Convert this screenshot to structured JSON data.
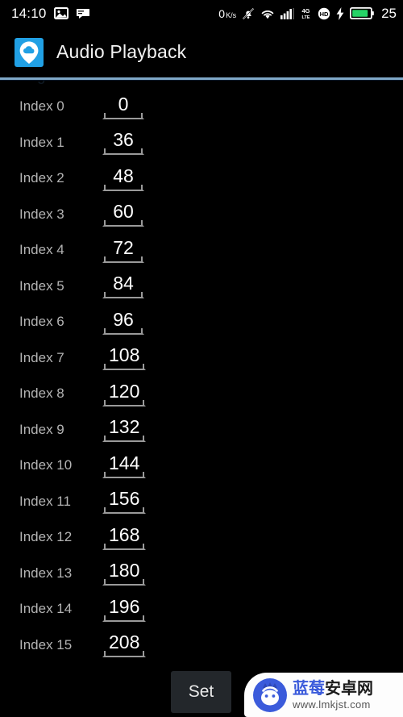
{
  "status_bar": {
    "clock": "14:10",
    "left_icons": [
      "image-icon",
      "message-icon"
    ],
    "data_rate": "0",
    "data_rate_unit": "K/s",
    "right_icons": [
      "mute-bell-icon",
      "wifi-icon",
      "signal-bars-icon",
      "4g-lte-icon",
      "hd-icon",
      "charging-bolt-icon",
      "battery-icon"
    ],
    "battery_percent": "25",
    "battery_color": "#25d366"
  },
  "app_bar": {
    "icon_name": "app-cloud-pin-icon",
    "icon_bg": "#21a0e4",
    "title": "Audio Playback"
  },
  "content": {
    "ghost_section_label": "Digital Gain",
    "divider_color": "#7fa8c9",
    "rows": [
      {
        "label": "Index 0",
        "value": "0"
      },
      {
        "label": "Index 1",
        "value": "36"
      },
      {
        "label": "Index 2",
        "value": "48"
      },
      {
        "label": "Index 3",
        "value": "60"
      },
      {
        "label": "Index 4",
        "value": "72"
      },
      {
        "label": "Index 5",
        "value": "84"
      },
      {
        "label": "Index 6",
        "value": "96"
      },
      {
        "label": "Index 7",
        "value": "108"
      },
      {
        "label": "Index 8",
        "value": "120"
      },
      {
        "label": "Index 9",
        "value": "132"
      },
      {
        "label": "Index 10",
        "value": "144"
      },
      {
        "label": "Index 11",
        "value": "156"
      },
      {
        "label": "Index 12",
        "value": "168"
      },
      {
        "label": "Index 13",
        "value": "180"
      },
      {
        "label": "Index 14",
        "value": "196"
      },
      {
        "label": "Index 15",
        "value": "208"
      }
    ]
  },
  "bottom_bar": {
    "set_label": "Set"
  },
  "watermark": {
    "logo_name": "blueberry-android-mascot-icon",
    "brand_blue": "蓝莓",
    "brand_dark": "安卓网",
    "url": "www.lmkjst.com",
    "accent": "#3b5bdb"
  }
}
